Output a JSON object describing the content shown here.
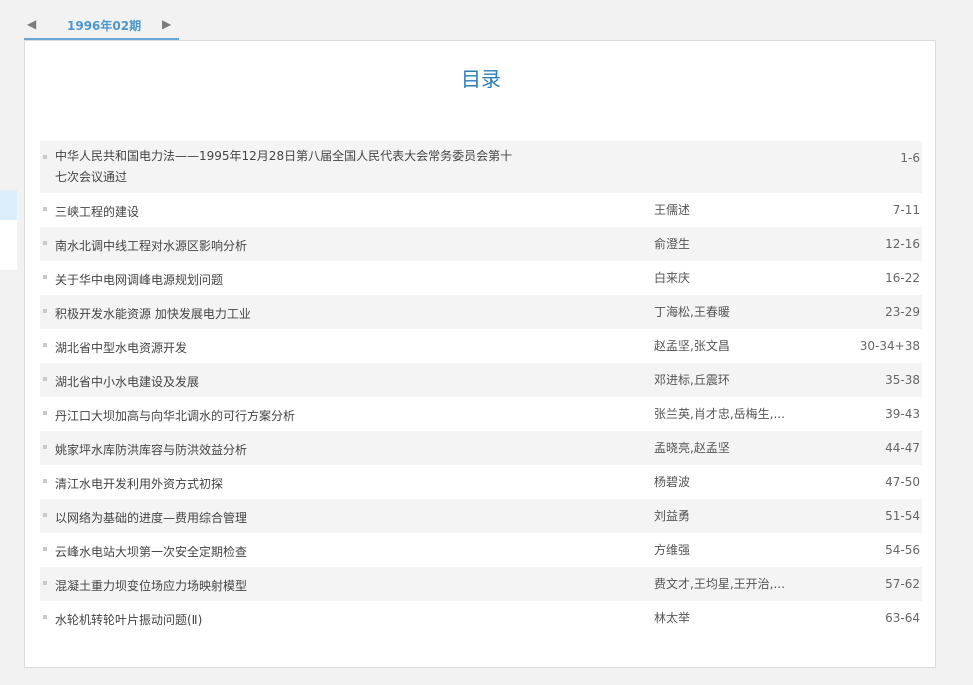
{
  "nav": {
    "prev_glyph": "◀",
    "next_glyph": "▶",
    "issue_label": "1996年02期"
  },
  "toc": {
    "title": "目录",
    "articles": [
      {
        "title": "中华人民共和国电力法——1995年12月28日第八届全国人民代表大会常务委员会第十七次会议通过",
        "author": "",
        "pages": "1-6"
      },
      {
        "title": "三峡工程的建设",
        "author": "王儒述",
        "pages": "7-11"
      },
      {
        "title": "南水北调中线工程对水源区影响分析",
        "author": "俞澄生",
        "pages": "12-16"
      },
      {
        "title": "关于华中电网调峰电源规划问题",
        "author": "白来庆",
        "pages": "16-22"
      },
      {
        "title": "积极开发水能资源 加快发展电力工业",
        "author": "丁海松,王春暖",
        "pages": "23-29"
      },
      {
        "title": "湖北省中型水电资源开发",
        "author": "赵孟坚,张文昌",
        "pages": "30-34+38"
      },
      {
        "title": "湖北省中小水电建设及发展",
        "author": "邓进标,丘震环",
        "pages": "35-38"
      },
      {
        "title": "丹江口大坝加高与向华北调水的可行方案分析",
        "author": "张兰英,肖才忠,岳梅生,...",
        "pages": "39-43"
      },
      {
        "title": "姚家坪水库防洪库容与防洪效益分析",
        "author": "孟晓亮,赵孟坚",
        "pages": "44-47"
      },
      {
        "title": "清江水电开发利用外资方式初探",
        "author": "杨碧波",
        "pages": "47-50"
      },
      {
        "title": "以网络为基础的进度—费用综合管理",
        "author": "刘益勇",
        "pages": "51-54"
      },
      {
        "title": "云峰水电站大坝第一次安全定期检查",
        "author": "方维强",
        "pages": "54-56"
      },
      {
        "title": "混凝土重力坝变位场应力场映射模型",
        "author": "费文才,王均星,王开治,...",
        "pages": "57-62"
      },
      {
        "title": "水轮机转轮叶片振动问题(Ⅱ)",
        "author": "林太举",
        "pages": "63-64"
      }
    ]
  }
}
